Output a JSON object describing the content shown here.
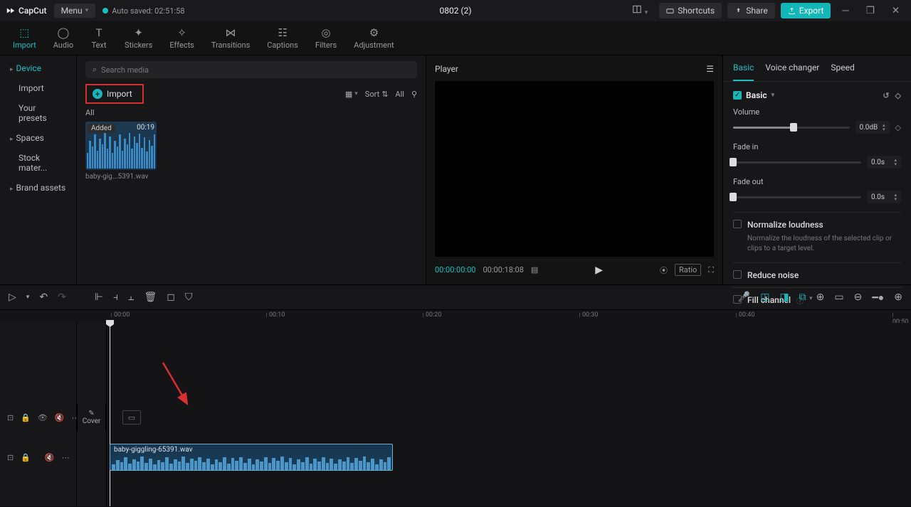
{
  "titlebar": {
    "app": "CapCut",
    "menu": "Menu",
    "autosave": "Auto saved: 02:51:58",
    "project": "0802 (2)",
    "shortcuts": "Shortcuts",
    "share": "Share",
    "export": "Export"
  },
  "topTabs": {
    "import": "Import",
    "audio": "Audio",
    "text": "Text",
    "stickers": "Stickers",
    "effects": "Effects",
    "transitions": "Transitions",
    "captions": "Captions",
    "filters": "Filters",
    "adjustment": "Adjustment"
  },
  "leftSidebar": {
    "device": "Device",
    "import": "Import",
    "presets": "Your presets",
    "spaces": "Spaces",
    "stock": "Stock mater...",
    "brand": "Brand assets"
  },
  "media": {
    "searchPlaceholder": "Search media",
    "importBtn": "Import",
    "sort": "Sort",
    "all": "All",
    "filter": "All",
    "thumb": {
      "added": "Added",
      "duration": "00:19",
      "name": "baby-gig...5391.wav"
    }
  },
  "player": {
    "title": "Player",
    "curTime": "00:00:00:00",
    "totalTime": "00:00:18:08",
    "ratio": "Ratio"
  },
  "props": {
    "tabs": {
      "basic": "Basic",
      "voice": "Voice changer",
      "speed": "Speed"
    },
    "sectionBasic": "Basic",
    "volume": {
      "label": "Volume",
      "value": "0.0dB"
    },
    "fadeIn": {
      "label": "Fade in",
      "value": "0.0s"
    },
    "fadeOut": {
      "label": "Fade out",
      "value": "0.0s"
    },
    "normalize": {
      "label": "Normalize loudness",
      "desc": "Normalize the loudness of the selected clip or clips to a target level."
    },
    "reduceNoise": "Reduce noise",
    "fillChannel": "Fill channel"
  },
  "timeline": {
    "cover": "Cover",
    "marks": [
      "00:00",
      "00:10",
      "00:20",
      "00:30",
      "00:40",
      "00:50"
    ],
    "clipName": "baby-giggling-65391.wav"
  }
}
